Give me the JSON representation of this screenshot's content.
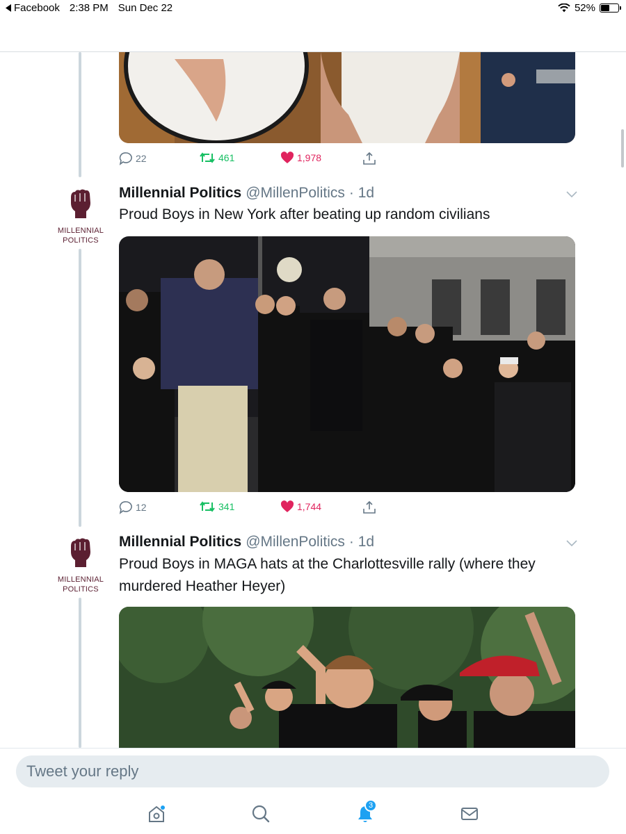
{
  "status_bar": {
    "back_app": "Facebook",
    "time": "2:38 PM",
    "date": "Sun Dec 22",
    "battery": "52%",
    "battery_level": 0.52
  },
  "tweets": [
    {
      "media_alt": "courtroom photo",
      "stats": {
        "replies": "22",
        "retweets": "461",
        "likes": "1,978"
      }
    },
    {
      "author": {
        "name": "Millennial Politics",
        "handle": "@MillenPolitics",
        "time": "· 1d",
        "avatar_text": [
          "MILLENNIAL",
          "POLITICS"
        ]
      },
      "text": "Proud Boys in New York after beating up random civilians",
      "stats": {
        "replies": "12",
        "retweets": "341",
        "likes": "1,744"
      }
    },
    {
      "author": {
        "name": "Millennial Politics",
        "handle": "@MillenPolitics",
        "time": "· 1d",
        "avatar_text": [
          "MILLENNIAL",
          "POLITICS"
        ]
      },
      "text": "Proud Boys in MAGA hats at the Charlottesville rally (where they murdered Heather Heyer)"
    }
  ],
  "reply_box": {
    "placeholder": "Tweet your reply"
  },
  "tab_bar": {
    "notification_count": "3"
  },
  "colors": {
    "accent": "#1da1f2",
    "retweet": "#17bf63",
    "like": "#e0245e",
    "brand": "#5b1f31"
  },
  "icons": [
    "back-arrow-icon",
    "wifi-icon",
    "battery-icon",
    "reply-icon",
    "retweet-icon",
    "heart-icon",
    "share-icon",
    "chevron-down-icon",
    "home-icon",
    "search-icon",
    "bell-icon",
    "mail-icon"
  ]
}
